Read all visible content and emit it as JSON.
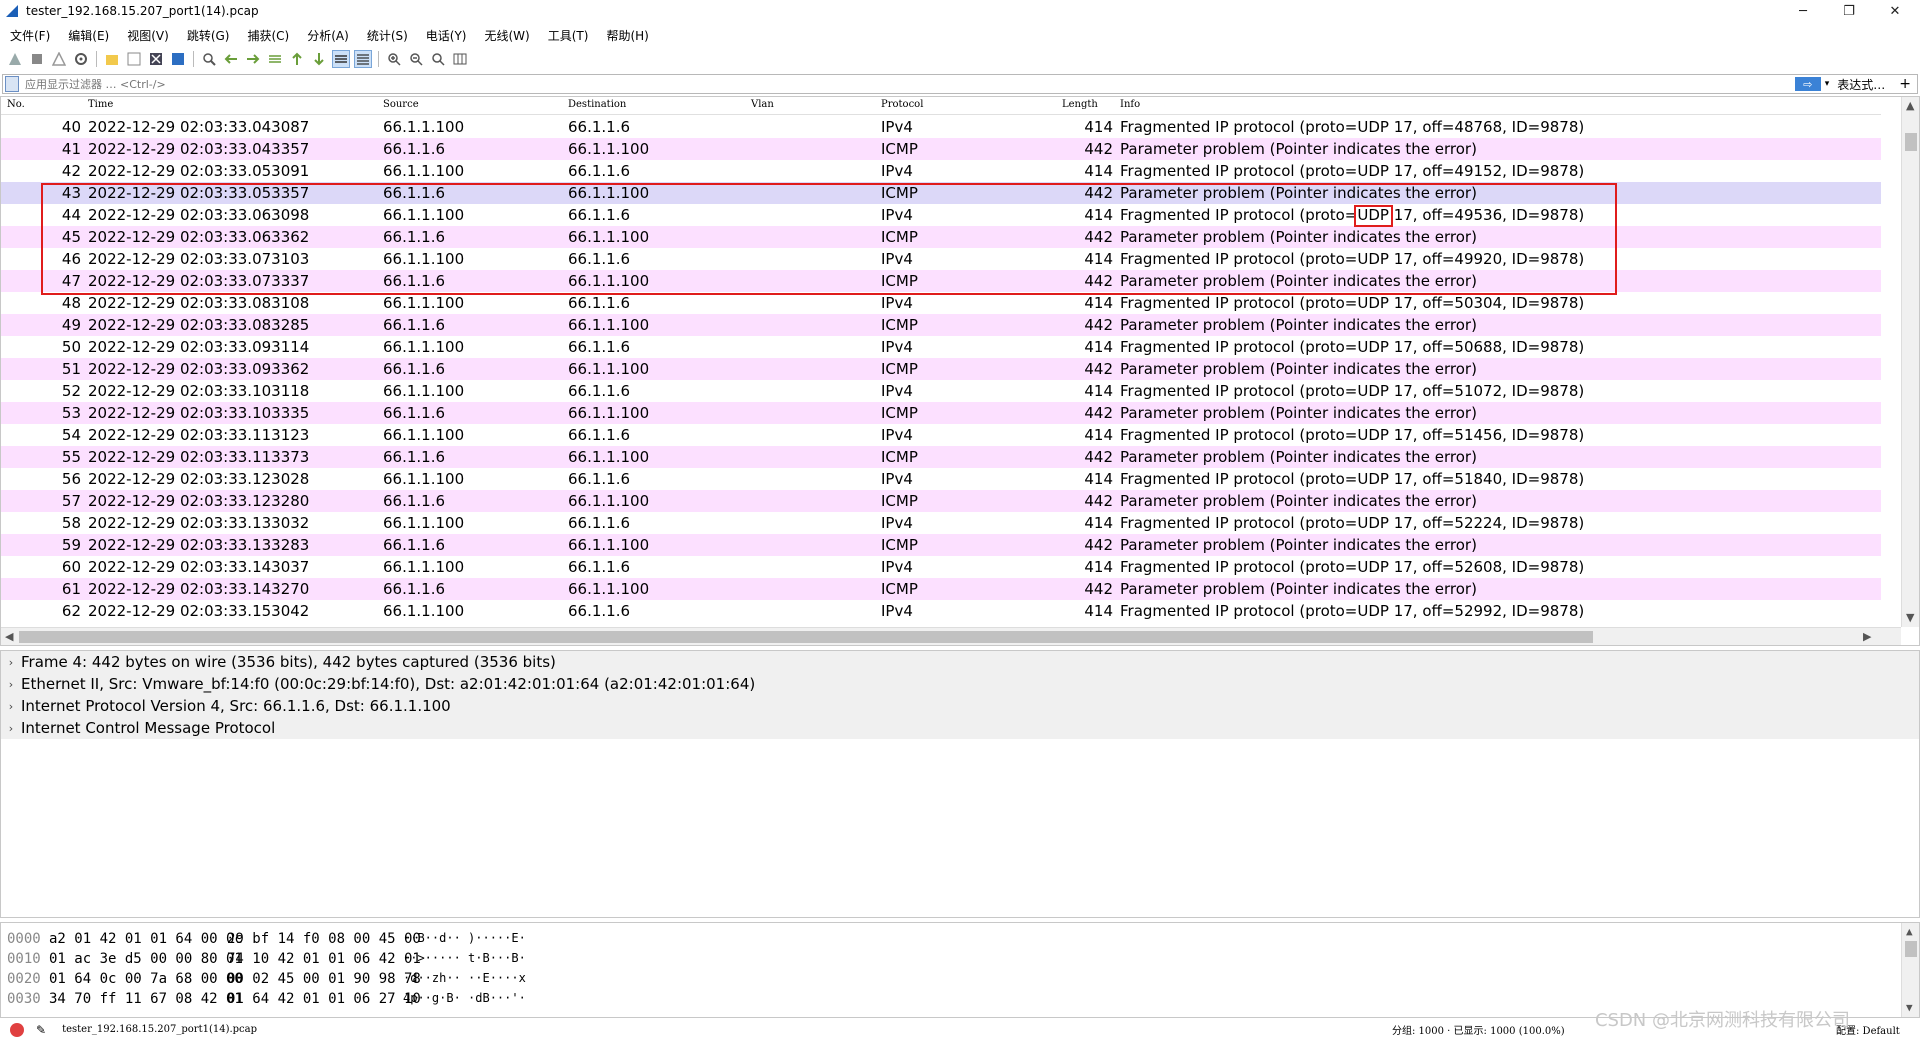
{
  "window": {
    "title": "tester_192.168.15.207_port1(14).pcap",
    "minimize": "─",
    "restore": "❐",
    "close": "✕"
  },
  "menu": [
    "文件(F)",
    "编辑(E)",
    "视图(V)",
    "跳转(G)",
    "捕获(C)",
    "分析(A)",
    "统计(S)",
    "电话(Y)",
    "无线(W)",
    "工具(T)",
    "帮助(H)"
  ],
  "filter": {
    "placeholder": "应用显示过滤器 … <Ctrl-/>",
    "apply_glyph": "⇨",
    "dropdown_glyph": "▾",
    "expression_label": "表达式…",
    "add_label": "+"
  },
  "columns": {
    "no": "No.",
    "time": "Time",
    "source": "Source",
    "destination": "Destination",
    "vlan": "Vlan",
    "protocol": "Protocol",
    "length": "Length",
    "info": "Info"
  },
  "packets": [
    {
      "no": "40",
      "time": "2022-12-29 02:03:33.043087",
      "src": "66.1.1.100",
      "dst": "66.1.1.6",
      "proto": "IPv4",
      "len": "414",
      "info": "Fragmented IP protocol (proto=UDP 17, off=48768, ID=9878)"
    },
    {
      "no": "41",
      "time": "2022-12-29 02:03:33.043357",
      "src": "66.1.1.6",
      "dst": "66.1.1.100",
      "proto": "ICMP",
      "len": "442",
      "info": "Parameter problem   (Pointer indicates the error)"
    },
    {
      "no": "42",
      "time": "2022-12-29 02:03:33.053091",
      "src": "66.1.1.100",
      "dst": "66.1.1.6",
      "proto": "IPv4",
      "len": "414",
      "info": "Fragmented IP protocol (proto=UDP 17, off=49152, ID=9878)"
    },
    {
      "no": "43",
      "time": "2022-12-29 02:03:33.053357",
      "src": "66.1.1.6",
      "dst": "66.1.1.100",
      "proto": "ICMP",
      "len": "442",
      "info": "Parameter problem   (Pointer indicates the error)"
    },
    {
      "no": "44",
      "time": "2022-12-29 02:03:33.063098",
      "src": "66.1.1.100",
      "dst": "66.1.1.6",
      "proto": "IPv4",
      "len": "414",
      "info": "Fragmented IP protocol (proto=UDP 17, off=49536, ID=9878)"
    },
    {
      "no": "45",
      "time": "2022-12-29 02:03:33.063362",
      "src": "66.1.1.6",
      "dst": "66.1.1.100",
      "proto": "ICMP",
      "len": "442",
      "info": "Parameter problem   (Pointer indicates the error)"
    },
    {
      "no": "46",
      "time": "2022-12-29 02:03:33.073103",
      "src": "66.1.1.100",
      "dst": "66.1.1.6",
      "proto": "IPv4",
      "len": "414",
      "info": "Fragmented IP protocol (proto=UDP 17, off=49920, ID=9878)"
    },
    {
      "no": "47",
      "time": "2022-12-29 02:03:33.073337",
      "src": "66.1.1.6",
      "dst": "66.1.1.100",
      "proto": "ICMP",
      "len": "442",
      "info": "Parameter problem   (Pointer indicates the error)"
    },
    {
      "no": "48",
      "time": "2022-12-29 02:03:33.083108",
      "src": "66.1.1.100",
      "dst": "66.1.1.6",
      "proto": "IPv4",
      "len": "414",
      "info": "Fragmented IP protocol (proto=UDP 17, off=50304, ID=9878)"
    },
    {
      "no": "49",
      "time": "2022-12-29 02:03:33.083285",
      "src": "66.1.1.6",
      "dst": "66.1.1.100",
      "proto": "ICMP",
      "len": "442",
      "info": "Parameter problem   (Pointer indicates the error)"
    },
    {
      "no": "50",
      "time": "2022-12-29 02:03:33.093114",
      "src": "66.1.1.100",
      "dst": "66.1.1.6",
      "proto": "IPv4",
      "len": "414",
      "info": "Fragmented IP protocol (proto=UDP 17, off=50688, ID=9878)"
    },
    {
      "no": "51",
      "time": "2022-12-29 02:03:33.093362",
      "src": "66.1.1.6",
      "dst": "66.1.1.100",
      "proto": "ICMP",
      "len": "442",
      "info": "Parameter problem   (Pointer indicates the error)"
    },
    {
      "no": "52",
      "time": "2022-12-29 02:03:33.103118",
      "src": "66.1.1.100",
      "dst": "66.1.1.6",
      "proto": "IPv4",
      "len": "414",
      "info": "Fragmented IP protocol (proto=UDP 17, off=51072, ID=9878)"
    },
    {
      "no": "53",
      "time": "2022-12-29 02:03:33.103335",
      "src": "66.1.1.6",
      "dst": "66.1.1.100",
      "proto": "ICMP",
      "len": "442",
      "info": "Parameter problem   (Pointer indicates the error)"
    },
    {
      "no": "54",
      "time": "2022-12-29 02:03:33.113123",
      "src": "66.1.1.100",
      "dst": "66.1.1.6",
      "proto": "IPv4",
      "len": "414",
      "info": "Fragmented IP protocol (proto=UDP 17, off=51456, ID=9878)"
    },
    {
      "no": "55",
      "time": "2022-12-29 02:03:33.113373",
      "src": "66.1.1.6",
      "dst": "66.1.1.100",
      "proto": "ICMP",
      "len": "442",
      "info": "Parameter problem   (Pointer indicates the error)"
    },
    {
      "no": "56",
      "time": "2022-12-29 02:03:33.123028",
      "src": "66.1.1.100",
      "dst": "66.1.1.6",
      "proto": "IPv4",
      "len": "414",
      "info": "Fragmented IP protocol (proto=UDP 17, off=51840, ID=9878)"
    },
    {
      "no": "57",
      "time": "2022-12-29 02:03:33.123280",
      "src": "66.1.1.6",
      "dst": "66.1.1.100",
      "proto": "ICMP",
      "len": "442",
      "info": "Parameter problem   (Pointer indicates the error)"
    },
    {
      "no": "58",
      "time": "2022-12-29 02:03:33.133032",
      "src": "66.1.1.100",
      "dst": "66.1.1.6",
      "proto": "IPv4",
      "len": "414",
      "info": "Fragmented IP protocol (proto=UDP 17, off=52224, ID=9878)"
    },
    {
      "no": "59",
      "time": "2022-12-29 02:03:33.133283",
      "src": "66.1.1.6",
      "dst": "66.1.1.100",
      "proto": "ICMP",
      "len": "442",
      "info": "Parameter problem   (Pointer indicates the error)"
    },
    {
      "no": "60",
      "time": "2022-12-29 02:03:33.143037",
      "src": "66.1.1.100",
      "dst": "66.1.1.6",
      "proto": "IPv4",
      "len": "414",
      "info": "Fragmented IP protocol (proto=UDP 17, off=52608, ID=9878)"
    },
    {
      "no": "61",
      "time": "2022-12-29 02:03:33.143270",
      "src": "66.1.1.6",
      "dst": "66.1.1.100",
      "proto": "ICMP",
      "len": "442",
      "info": "Parameter problem   (Pointer indicates the error)"
    },
    {
      "no": "62",
      "time": "2022-12-29 02:03:33.153042",
      "src": "66.1.1.100",
      "dst": "66.1.1.6",
      "proto": "IPv4",
      "len": "414",
      "info": "Fragmented IP protocol (proto=UDP 17, off=52992, ID=9878)"
    }
  ],
  "row_colors": {
    "ipv4": "#ffffff",
    "icmp": "#fce0ff",
    "selected": "#dcd8f8",
    "highlight_border": "#e01c1c"
  },
  "details": [
    "Frame 4: 442 bytes on wire (3536 bits), 442 bytes captured (3536 bits)",
    "Ethernet II, Src: Vmware_bf:14:f0 (00:0c:29:bf:14:f0), Dst: a2:01:42:01:01:64 (a2:01:42:01:01:64)",
    "Internet Protocol Version 4, Src: 66.1.1.6, Dst: 66.1.1.100",
    "Internet Control Message Protocol"
  ],
  "bytes": [
    {
      "off": "0000",
      "hex1": "a2 01 42 01 01 64 00 0c",
      "hex2": "29 bf 14 f0 08 00 45 00",
      "ascii": "··B··d·· )·····E·"
    },
    {
      "off": "0010",
      "hex1": "01 ac 3e d5 00 00 80 01",
      "hex2": "74 10 42 01 01 06 42 01",
      "ascii": "··>····· t·B···B·"
    },
    {
      "off": "0020",
      "hex1": "01 64 0c 00 7a 68 00 00",
      "hex2": "00 02 45 00 01 90 98 78",
      "ascii": "·d··zh·· ··E····x"
    },
    {
      "off": "0030",
      "hex1": "34 70 ff 11 67 08 42 01",
      "hex2": "01 64 42 01 01 06 27 10",
      "ascii": "4p··g·B· ·dB···'·"
    }
  ],
  "status": {
    "file": "tester_192.168.15.207_port1(14).pcap",
    "packets": "分组: 1000 · 已显示: 1000 (100.0%)",
    "profile": "配置: Default"
  },
  "watermark": "CSDN @北京网测科技有限公司"
}
